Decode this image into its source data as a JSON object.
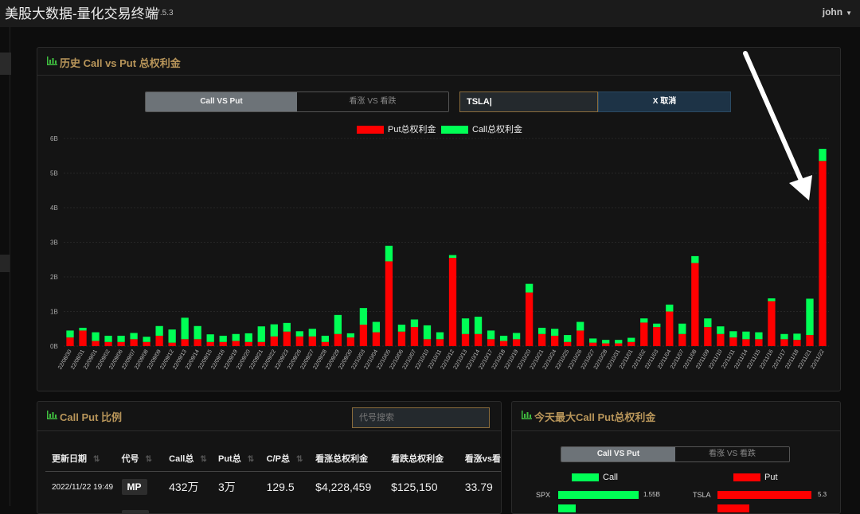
{
  "app": {
    "title": "美股大数据-量化交易终端",
    "version": "0.7.5.3",
    "user": "john"
  },
  "history_panel": {
    "title": "历史 Call vs Put 总权利金",
    "toggle": {
      "active": "Call VS Put",
      "inactive": "看涨 VS 看跌"
    },
    "search_value": "TSLA",
    "cancel_label": "X 取消",
    "legend": {
      "put": "Put总权利金",
      "call": "Call总权利金"
    }
  },
  "chart_data": {
    "type": "bar",
    "stacked": true,
    "ylim": [
      0,
      6
    ],
    "y_unit": "B",
    "y_ticks": [
      "0B",
      "1B",
      "2B",
      "3B",
      "4B",
      "5B",
      "6B"
    ],
    "colors": {
      "put": "#ff0000",
      "call": "#00ff55"
    },
    "categories": [
      "22/08/30",
      "22/08/31",
      "22/09/01",
      "22/09/02",
      "22/09/06",
      "22/09/07",
      "22/09/08",
      "22/09/09",
      "22/09/12",
      "22/09/13",
      "22/09/14",
      "22/09/15",
      "22/09/16",
      "22/09/19",
      "22/09/20",
      "22/09/21",
      "22/09/22",
      "22/09/23",
      "22/09/26",
      "22/09/27",
      "22/09/28",
      "22/09/29",
      "22/09/30",
      "22/10/03",
      "22/10/04",
      "22/10/05",
      "22/10/06",
      "22/10/07",
      "22/10/10",
      "22/10/11",
      "22/10/12",
      "22/10/13",
      "22/10/14",
      "22/10/17",
      "22/10/18",
      "22/10/19",
      "22/10/20",
      "22/10/21",
      "22/10/24",
      "22/10/25",
      "22/10/26",
      "22/10/27",
      "22/10/28",
      "22/10/31",
      "22/11/01",
      "22/11/02",
      "22/11/03",
      "22/11/04",
      "22/11/07",
      "22/11/08",
      "22/11/09",
      "22/11/10",
      "22/11/11",
      "22/11/14",
      "22/11/15",
      "22/11/16",
      "22/11/17",
      "22/11/18",
      "22/11/21",
      "22/11/22"
    ],
    "series": [
      {
        "name": "Put总权利金",
        "values": [
          0.25,
          0.45,
          0.15,
          0.12,
          0.12,
          0.2,
          0.12,
          0.3,
          0.1,
          0.2,
          0.2,
          0.12,
          0.12,
          0.15,
          0.12,
          0.12,
          0.28,
          0.42,
          0.28,
          0.28,
          0.12,
          0.35,
          0.25,
          0.62,
          0.4,
          2.45,
          0.42,
          0.55,
          0.2,
          0.2,
          2.55,
          0.35,
          0.35,
          0.2,
          0.15,
          0.2,
          1.55,
          0.35,
          0.3,
          0.12,
          0.45,
          0.1,
          0.08,
          0.08,
          0.12,
          0.68,
          0.55,
          1.0,
          0.35,
          2.4,
          0.55,
          0.35,
          0.25,
          0.2,
          0.2,
          1.3,
          0.2,
          0.18,
          0.32,
          5.35
        ]
      },
      {
        "name": "Call总权利金",
        "values": [
          0.2,
          0.08,
          0.25,
          0.18,
          0.18,
          0.18,
          0.15,
          0.28,
          0.38,
          0.62,
          0.38,
          0.22,
          0.18,
          0.2,
          0.25,
          0.45,
          0.35,
          0.25,
          0.15,
          0.22,
          0.18,
          0.55,
          0.12,
          0.48,
          0.3,
          0.45,
          0.2,
          0.22,
          0.4,
          0.2,
          0.08,
          0.45,
          0.5,
          0.25,
          0.15,
          0.18,
          0.25,
          0.18,
          0.2,
          0.2,
          0.25,
          0.12,
          0.1,
          0.1,
          0.12,
          0.12,
          0.1,
          0.2,
          0.3,
          0.2,
          0.25,
          0.22,
          0.18,
          0.22,
          0.2,
          0.08,
          0.15,
          0.18,
          1.05,
          0.35
        ]
      }
    ]
  },
  "ratio_panel": {
    "title": "Call Put 比例",
    "search_placeholder": "代号搜索",
    "columns": [
      "更新日期",
      "代号",
      "Call总",
      "Put总",
      "C/P总",
      "看涨总权利金",
      "看跌总权利金",
      "看涨vs看"
    ],
    "rows": [
      {
        "date": "2022/11/22 19:49",
        "code": "MP",
        "call": "432万",
        "put": "3万",
        "cp": "129.5",
        "bull": "$4,228,459",
        "bear": "$125,150",
        "ratio": "33.79"
      }
    ]
  },
  "today_panel": {
    "title": "今天最大Call Put总权利金",
    "toggle": {
      "active": "Call VS Put",
      "inactive": "看涨 VS 看跌"
    },
    "legend": {
      "call": "Call",
      "put": "Put"
    },
    "call_items": [
      {
        "label": "SPX",
        "value_text": "1.55B",
        "value": 1.55
      }
    ],
    "put_items": [
      {
        "label": "TSLA",
        "value_text": "5.3",
        "value": 5.3
      }
    ]
  }
}
